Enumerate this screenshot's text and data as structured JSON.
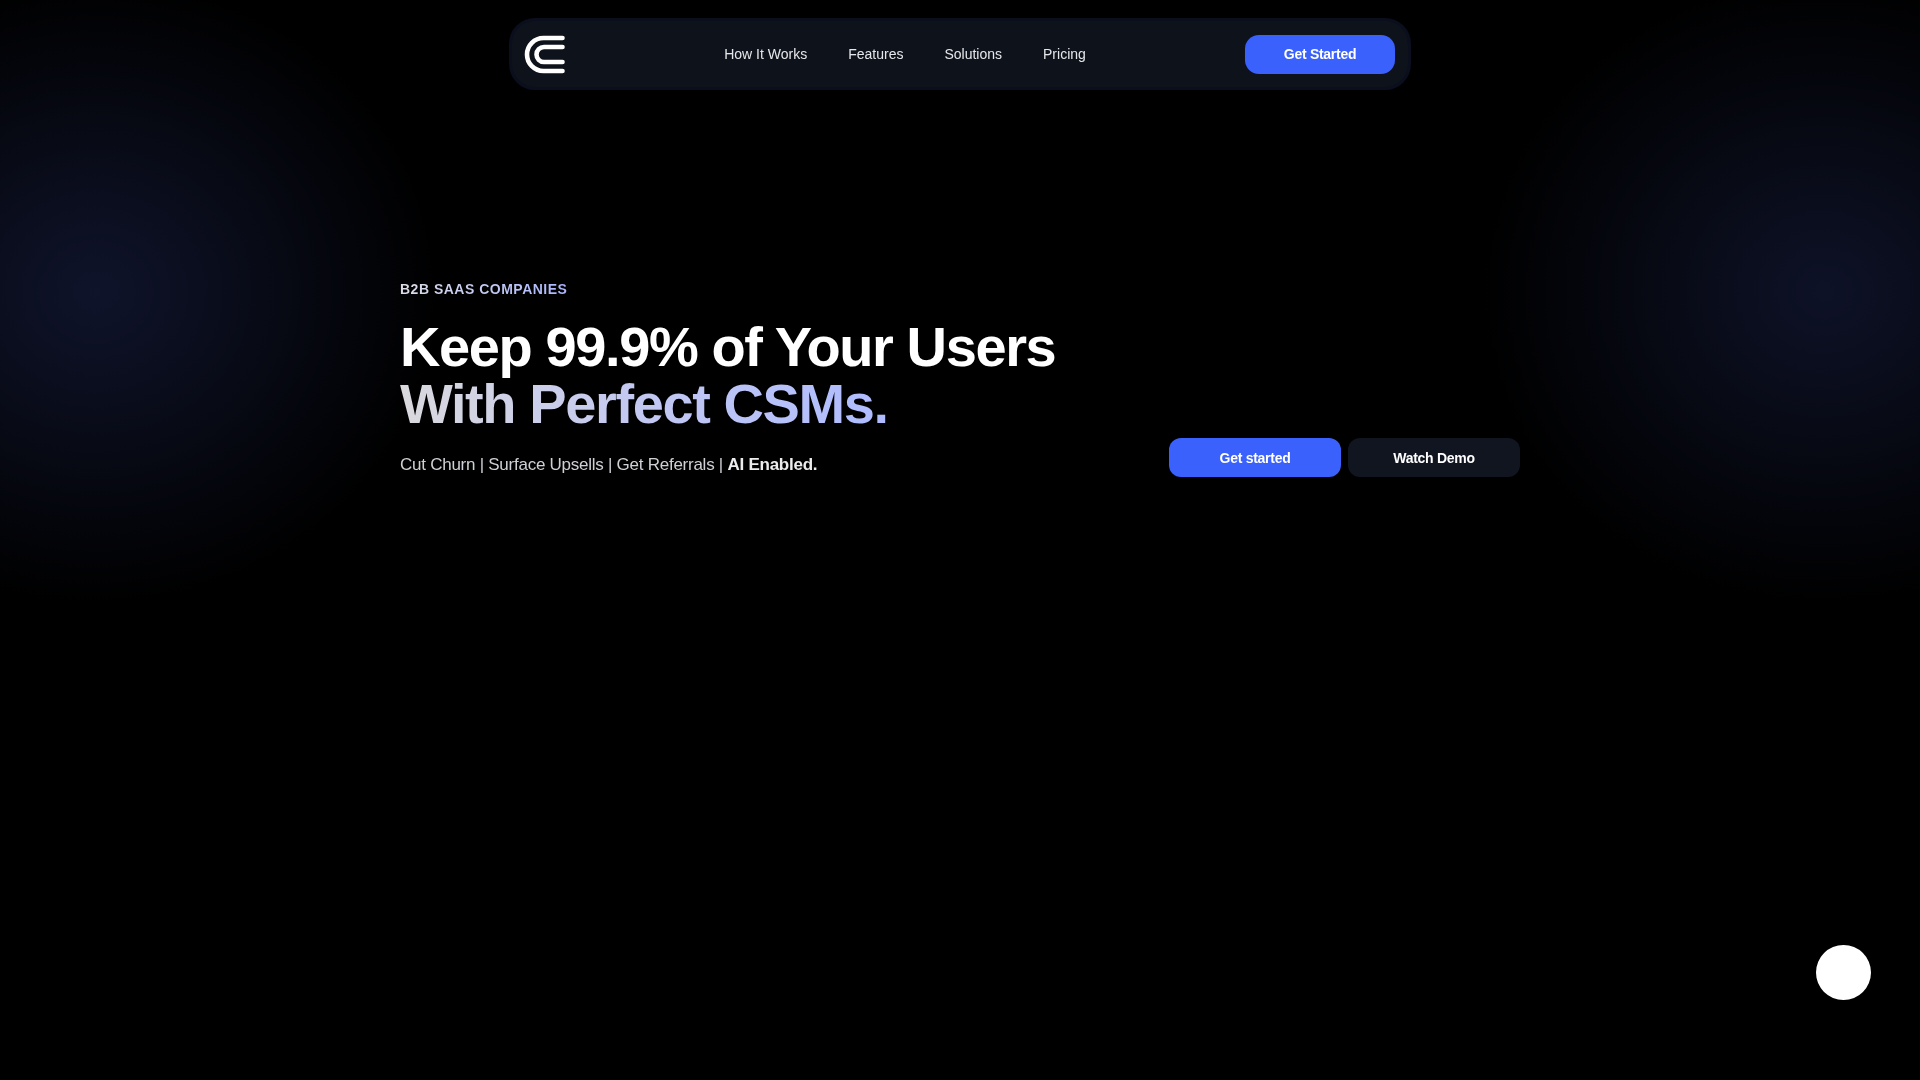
{
  "nav": {
    "links": [
      "How It Works",
      "Features",
      "Solutions",
      "Pricing"
    ],
    "cta": "Get Started"
  },
  "hero": {
    "eyebrow": "B2B SAAS COMPANIES",
    "headline": {
      "line_1": "Keep 99.9% of Your Users",
      "line_2": "With Perfect CSMs."
    },
    "subtitle": "Cut Churn | Surface Upsells | Get Referrals | **AI Enabled.**",
    "buttons": [
      {
        "label": "Get started",
        "kind": "primary"
      },
      {
        "label": "Watch Demo",
        "kind": "secondary"
      }
    ]
  }
}
